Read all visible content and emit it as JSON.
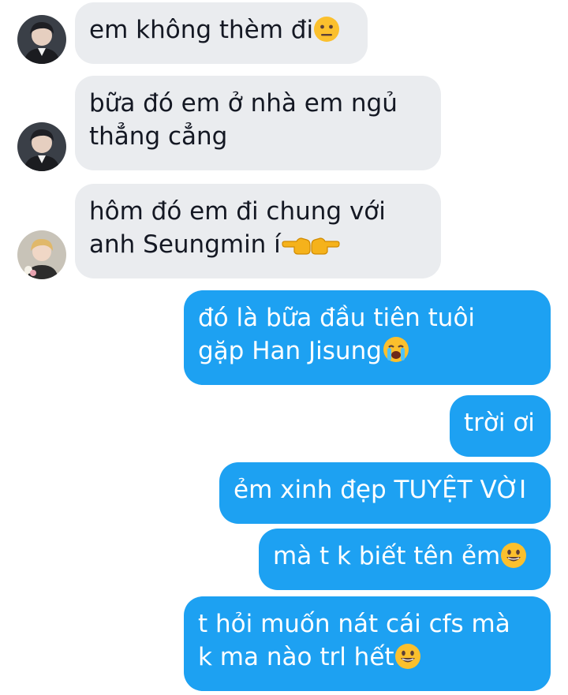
{
  "messages": [
    {
      "side": "in",
      "avatar": "avatar-dark-hair-person",
      "lines": [
        "em không thèm đi"
      ],
      "emoji": [
        "neutral-face-emoji"
      ]
    },
    {
      "side": "in",
      "avatar": "avatar-dark-hair-person",
      "lines": [
        "bữa đó em ở nhà em ngủ",
        "thẳng cẳng"
      ]
    },
    {
      "side": "in",
      "avatar": "avatar-blonde-person-flowers",
      "lines": [
        "hôm đó em đi chung với",
        "anh Seungmin í"
      ],
      "emoji": [
        "pointing-left-emoji",
        "pointing-right-emoji"
      ]
    },
    {
      "side": "out",
      "lines": [
        "đó là bữa đầu tiên tuôi",
        "gặp Han Jisung"
      ],
      "emoji": [
        "crying-face-emoji"
      ]
    },
    {
      "side": "out",
      "lines": [
        "trời ơi"
      ]
    },
    {
      "side": "out",
      "lines": [
        "ẻm xinh đẹp TUYỆT VỜI"
      ]
    },
    {
      "side": "out",
      "lines": [
        "mà t k biết tên ẻm"
      ],
      "emoji": [
        "grinning-face-emoji"
      ]
    },
    {
      "side": "out",
      "lines": [
        "t hỏi muốn nát cái cfs mà",
        "k ma nào trl hết"
      ],
      "emoji": [
        "grinning-face-emoji"
      ]
    }
  ],
  "colors": {
    "incoming_bubble": "#eaecef",
    "outgoing_bubble": "#1da1f2",
    "incoming_text": "#141823",
    "outgoing_text": "#ffffff"
  }
}
